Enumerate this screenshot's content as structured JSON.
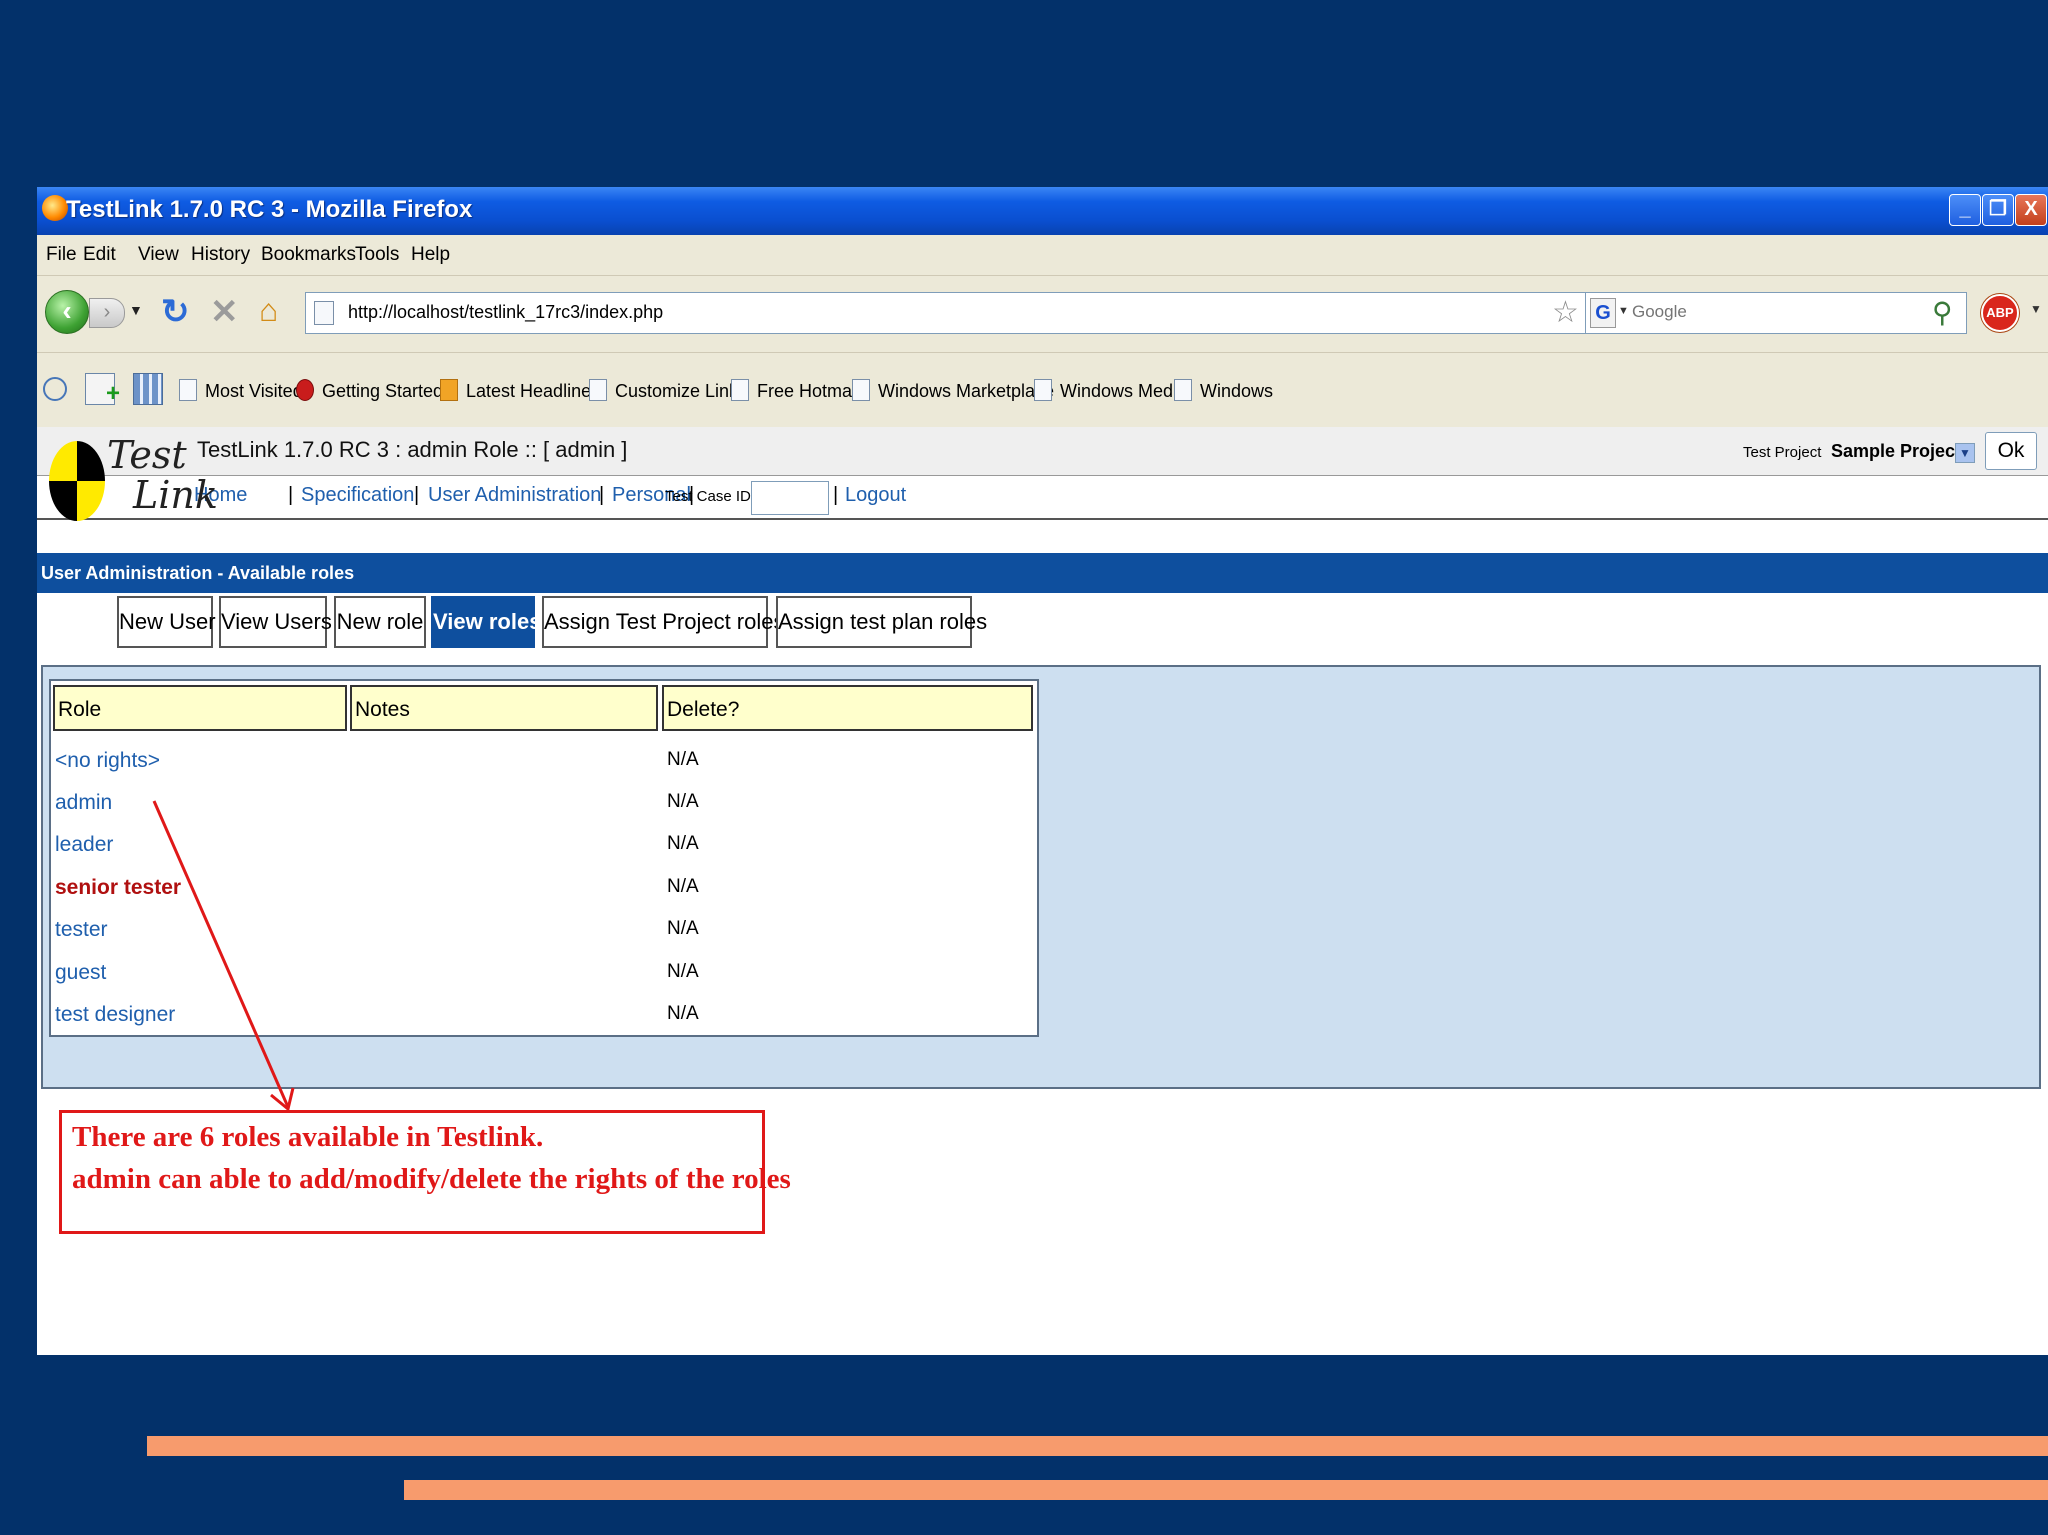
{
  "window": {
    "title": "TestLink 1.7.0 RC 3 - Mozilla Firefox",
    "controls": {
      "minimize": "_",
      "maximize": "❐",
      "close": "X"
    }
  },
  "menu": [
    "File",
    "Edit",
    "View",
    "History",
    "Bookmarks",
    "Tools",
    "Help"
  ],
  "navigation": {
    "url": "http://localhost/testlink_17rc3/index.php",
    "search_placeholder": "Google",
    "search_engine_letter": "G",
    "adblock_label": "ABP"
  },
  "bookmarks": [
    "Most Visited",
    "Getting Started",
    "Latest Headlines",
    "Customize Links",
    "Free Hotmail",
    "Windows Marketplace",
    "Windows Media",
    "Windows"
  ],
  "testlink": {
    "logo": {
      "word1": "Test",
      "word2": "Link"
    },
    "header_title": "TestLink 1.7.0 RC 3 : admin Role :: [ admin ]",
    "test_project_label": "Test Project",
    "test_project_value": "Sample Project",
    "ok_label": "Ok",
    "nav": {
      "home": "Home",
      "specification": "Specification",
      "user_admin": "User Administration",
      "personal": "Personal",
      "test_case_id_label": "Test Case ID:",
      "logout": "Logout",
      "separator": "|"
    },
    "section_title": "User Administration - Available roles",
    "tabs": [
      "New User",
      "View Users",
      "New role",
      "View roles",
      "Assign Test Project roles",
      "Assign test plan roles"
    ],
    "active_tab": "View roles",
    "table": {
      "headers": [
        "Role",
        "Notes",
        "Delete?"
      ],
      "rows": [
        {
          "role": "<no rights>",
          "delete": "N/A"
        },
        {
          "role": "admin",
          "delete": "N/A"
        },
        {
          "role": "leader",
          "delete": "N/A"
        },
        {
          "role": "senior tester",
          "delete": "N/A"
        },
        {
          "role": "tester",
          "delete": "N/A"
        },
        {
          "role": "guest",
          "delete": "N/A"
        },
        {
          "role": "test designer",
          "delete": "N/A"
        }
      ]
    }
  },
  "annotation": {
    "line1": "There are 6 roles available in Testlink.",
    "line2": "admin can able to add/modify/delete the rights of the roles",
    "color": "#e01818"
  },
  "colors": {
    "slide_background": "#03316a",
    "stripe": "#f79b6d",
    "section_bar": "#0e4f9e",
    "table_header": "#ffffcc",
    "panel": "#cddff0",
    "link": "#1f5fad",
    "highlight_role": "#b01010"
  }
}
